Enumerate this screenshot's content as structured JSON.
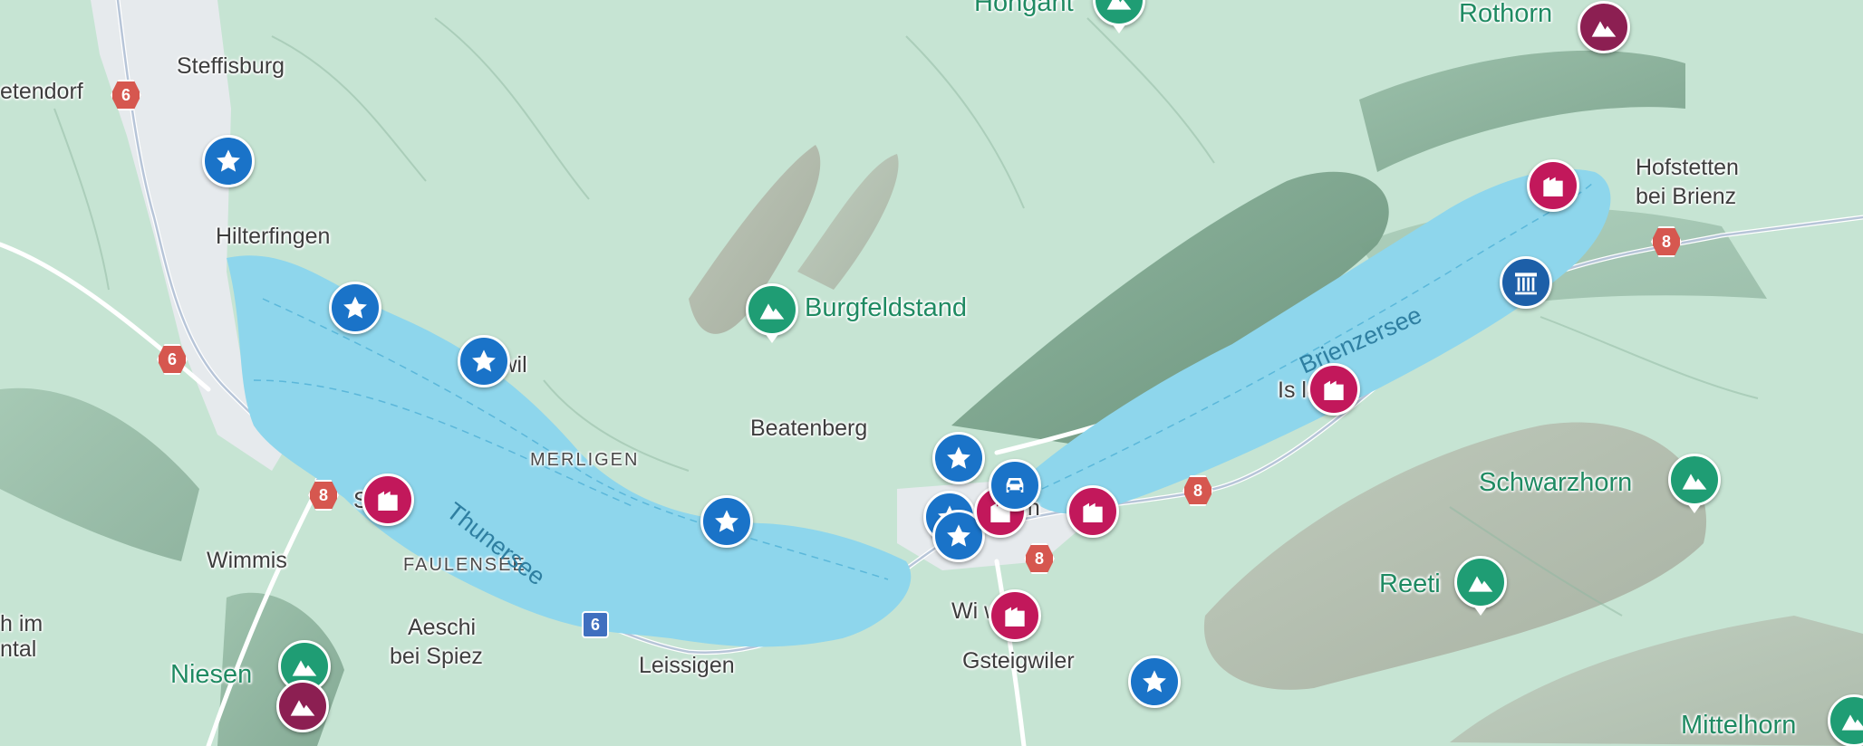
{
  "colors": {
    "lake": "#8ed6ec",
    "terrain": "#c9e6d6",
    "town": "#e8ecef",
    "peak_green": "#1f9d74",
    "peak_purple": "#8c1f52",
    "building_red": "#c2185b",
    "star_blue": "#1a73c8",
    "waterfall_blue": "#1d5fa8",
    "road_shield": "#d6574f"
  },
  "places": {
    "steffisburg": "Steffisburg",
    "uetendorf": "etendorf",
    "hilterfingen": "Hilterfingen",
    "oberhofen": "swil",
    "merligen": "MERLIGEN",
    "beatenberg": "Beatenberg",
    "burgfeldstand": "Burgfeldstand",
    "spiez": "S",
    "wimmis": "Wimmis",
    "faulensee": "FAULENSEE",
    "aeschi_1": "Aeschi",
    "aeschi_2": "bei Spiez",
    "leissigen": "Leissigen",
    "niesen": "Niesen",
    "frutigen_1": "h im",
    "frutigen_2": "ntal",
    "interlaken": "en",
    "wilderswil": "Wi        wil",
    "gsteigwiler": "Gsteigwiler",
    "iseltwald": "Is         ld",
    "brienz": "B",
    "hofstetten_1": "Hofstetten",
    "hofstetten_2": "bei Brienz",
    "rothorn": "Rothorn",
    "hohgant": "Hohgant",
    "schwarzhorn": "Schwarzhorn",
    "reeti": "Reeti",
    "mittelhorn": "Mittelhorn"
  },
  "lakes": {
    "thunersee": "Thunersee",
    "brienzersee": "Brienzersee"
  },
  "road_shields": {
    "r6_a": "6",
    "r6_b": "6",
    "r6_c": "6",
    "r8_a": "8",
    "r8_b": "8",
    "r8_c": "8",
    "r8_d": "8"
  },
  "pins": [
    {
      "name": "star-marker",
      "icon": "star-icon",
      "color": "#1a73c8"
    },
    {
      "name": "star-marker",
      "icon": "star-icon",
      "color": "#1a73c8"
    },
    {
      "name": "star-marker",
      "icon": "star-icon",
      "color": "#1a73c8"
    },
    {
      "name": "star-marker",
      "icon": "star-icon",
      "color": "#1a73c8"
    },
    {
      "name": "star-marker",
      "icon": "star-icon",
      "color": "#1a73c8"
    },
    {
      "name": "star-marker",
      "icon": "star-icon",
      "color": "#1a73c8"
    },
    {
      "name": "star-marker",
      "icon": "star-icon",
      "color": "#1a73c8"
    },
    {
      "name": "star-marker",
      "icon": "star-icon",
      "color": "#1a73c8"
    },
    {
      "name": "building-marker",
      "icon": "building-icon",
      "color": "#c2185b"
    },
    {
      "name": "building-marker",
      "icon": "building-icon",
      "color": "#c2185b"
    },
    {
      "name": "building-marker",
      "icon": "building-icon",
      "color": "#c2185b"
    },
    {
      "name": "building-marker",
      "icon": "building-icon",
      "color": "#c2185b"
    },
    {
      "name": "building-marker",
      "icon": "building-icon",
      "color": "#c2185b"
    },
    {
      "name": "building-marker",
      "icon": "building-icon",
      "color": "#c2185b"
    },
    {
      "name": "peak-marker",
      "icon": "mountain-icon",
      "color": "#1f9d74"
    },
    {
      "name": "peak-marker",
      "icon": "mountain-icon",
      "color": "#1f9d74"
    },
    {
      "name": "peak-marker",
      "icon": "mountain-icon",
      "color": "#1f9d74"
    },
    {
      "name": "peak-marker",
      "icon": "mountain-icon",
      "color": "#1f9d74"
    },
    {
      "name": "peak-marker",
      "icon": "mountain-icon",
      "color": "#1f9d74"
    },
    {
      "name": "peak-marker",
      "icon": "mountain-icon",
      "color": "#1f9d74"
    },
    {
      "name": "summit-marker",
      "icon": "mountain-icon",
      "color": "#8c1f52"
    },
    {
      "name": "summit-marker",
      "icon": "mountain-icon",
      "color": "#8c1f52"
    },
    {
      "name": "waterfall-marker",
      "icon": "waterfall-icon",
      "color": "#1d5fa8"
    },
    {
      "name": "car-marker",
      "icon": "car-icon",
      "color": "#1a73c8"
    }
  ]
}
